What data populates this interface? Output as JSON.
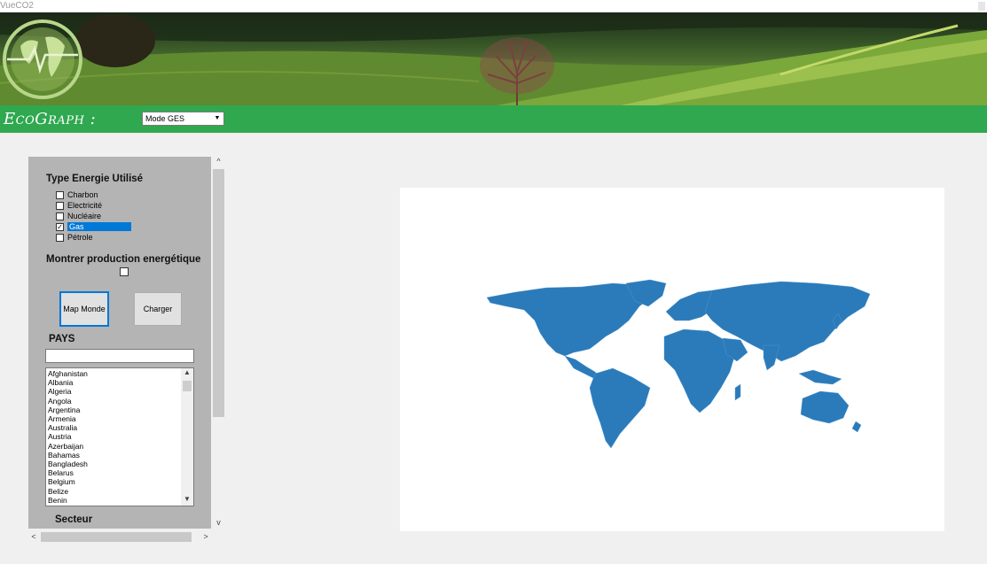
{
  "window": {
    "title": "VueCO2"
  },
  "header": {
    "brand": "EcoGraph :"
  },
  "mode_select": {
    "value": "Mode GES"
  },
  "energy_panel": {
    "title": "Type Energie Utilisé",
    "options": [
      {
        "label": "Charbon",
        "checked": false
      },
      {
        "label": "Electricité",
        "checked": false
      },
      {
        "label": "Nucléaire",
        "checked": false
      },
      {
        "label": "Gas",
        "checked": true,
        "selected": true
      },
      {
        "label": "Pétrole",
        "checked": false
      }
    ],
    "production_label": "Montrer production energétique"
  },
  "buttons": {
    "map": "Map Monde",
    "load": "Charger"
  },
  "pays": {
    "title": "PAYS",
    "search_value": "",
    "countries": [
      "Afghanistan",
      "Albania",
      "Algeria",
      "Angola",
      "Argentina",
      "Armenia",
      "Australia",
      "Austria",
      "Azerbaijan",
      "Bahamas",
      "Bangladesh",
      "Belarus",
      "Belgium",
      "Belize",
      "Benin"
    ]
  },
  "secteur": {
    "title": "Secteur"
  },
  "colors": {
    "accent": "#2fa84f",
    "map_fill": "#2b7bba",
    "selection": "#0078d7"
  }
}
